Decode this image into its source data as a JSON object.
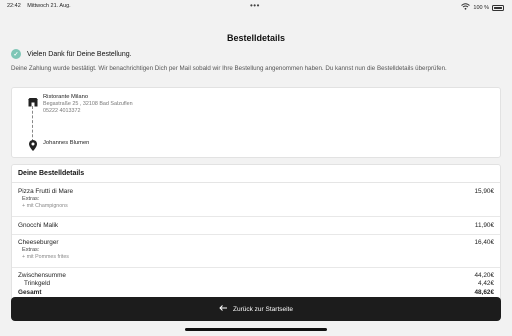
{
  "status_bar": {
    "time": "22:42",
    "date": "Mittwoch 21. Aug.",
    "dots": "•••",
    "battery_text": "100 %"
  },
  "page": {
    "title": "Bestelldetails"
  },
  "confirmation": {
    "message": "Vielen Dank für Deine Bestellung.",
    "notice": "Deine Zahlung wurde bestätigt. Wir benachrichtigen Dich per Mail sobald wir Ihre Bestellung angenommen haben. Du kannst nun die Bestelldetails überprüfen."
  },
  "restaurant": {
    "name": "Ristorante Milano",
    "address": "Begastraße 25 , 32108 Bad Salzuflen",
    "phone": "05222 4013372"
  },
  "customer": {
    "name": "Johannes Blumen"
  },
  "order": {
    "title": "Deine Bestelldetails",
    "items": [
      {
        "name": "Pizza Frutti di Mare",
        "price": "15,90€",
        "extras_label": "Extras:",
        "extras": "+ mit Champignons"
      },
      {
        "name": "Gnocchi Malik",
        "price": "11,90€"
      },
      {
        "name": "Cheeseburger",
        "price": "16,40€",
        "extras_label": "Extras:",
        "extras": "+ mit Pommes frites"
      }
    ],
    "subtotal_label": "Zwischensumme",
    "subtotal": "44,20€",
    "tip_label": "Trinkgeld",
    "tip": "4,42€",
    "total_label": "Gesamt",
    "total": "48,62€"
  },
  "footer": {
    "back_button_label": "Zurück zur Startseite"
  }
}
